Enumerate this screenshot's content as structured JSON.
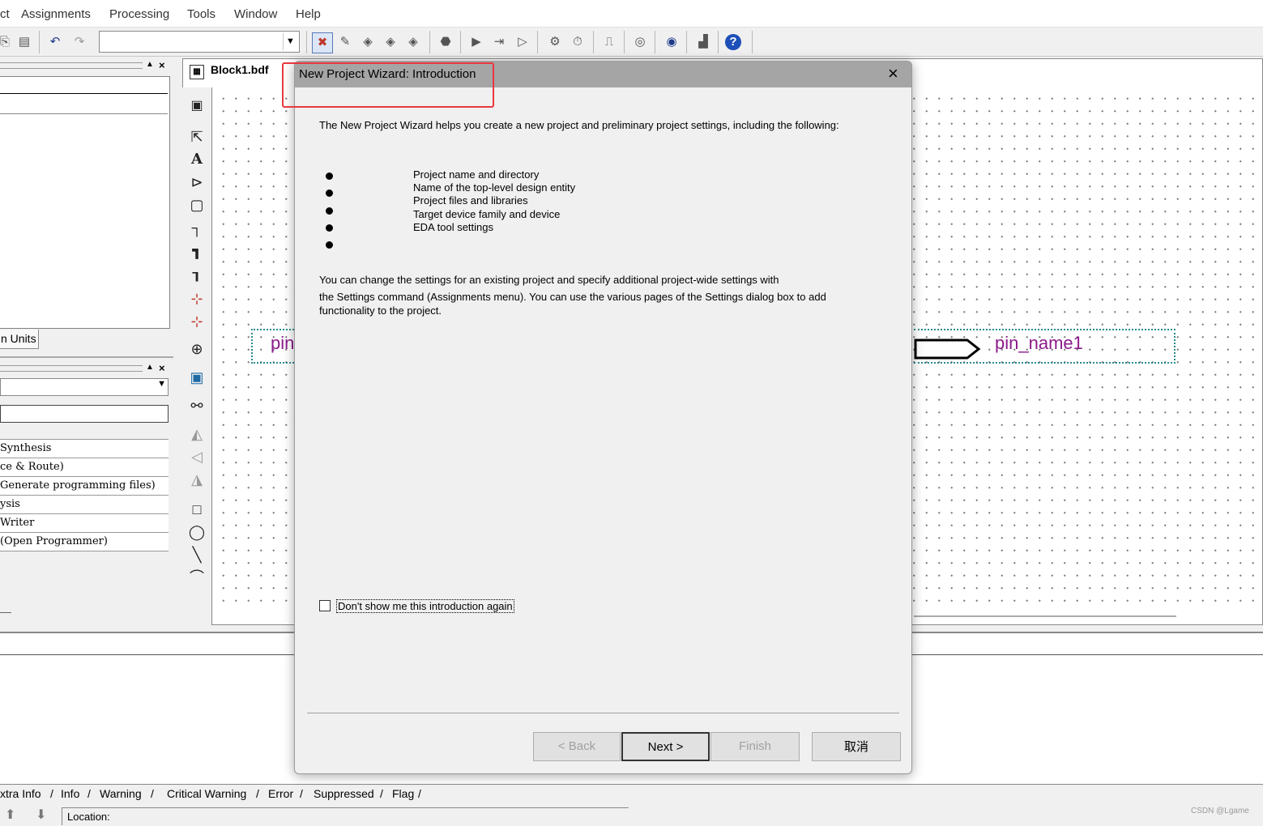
{
  "menu": {
    "items": [
      "ct",
      "Assignments",
      "Processing",
      "Tools",
      "Window",
      "Help"
    ]
  },
  "toolbar": {
    "combo_value": "",
    "icons": [
      "copy-icon",
      "paste-icon",
      "undo-icon",
      "redo-icon",
      "compile-icon",
      "analysis-icon",
      "fitter-icon",
      "assembler-icon",
      "timing-icon",
      "stop-icon",
      "start-icon",
      "start-next-icon",
      "step-icon",
      "rtl-icon",
      "clock-icon",
      "simulate-icon",
      "programmer-icon",
      "chip-icon",
      "netlist-icon",
      "help-icon"
    ]
  },
  "left_panel": {
    "units_tab": "n Units",
    "tasks": [
      "Synthesis",
      "ce & Route)",
      "Generate programming files)",
      "ysis",
      " Writer",
      " (Open Programmer)"
    ]
  },
  "editor": {
    "tab_title": "Block1.bdf",
    "pin_left_label": "pin",
    "pin_right_label": "pin_name1"
  },
  "dialog": {
    "title": "New Project Wizard: Introduction",
    "intro": "The New Project Wizard helps you create a new project and preliminary project settings, including the following:",
    "bullets": [
      "Project name and directory",
      "Name of the top-level design entity",
      "Project files and libraries",
      "Target device family and device",
      "EDA tool settings"
    ],
    "para_line1": "You can change the settings for an existing project and specify additional project-wide settings with",
    "para_line2": "the Settings command (Assignments menu). You can use the various pages of the Settings dialog box to add",
    "para_line3": "functionality to the project.",
    "checkbox_label": "Don't show me this introduction again",
    "checkbox_checked": false,
    "buttons": {
      "back": "< Back",
      "next": "Next >",
      "finish": "Finish",
      "cancel": "取消"
    }
  },
  "messages": {
    "tabs": [
      "xtra Info",
      "Info",
      "Warning",
      "Critical Warning",
      "Error",
      "Suppressed",
      "Flag"
    ],
    "location_label": "Location:"
  },
  "watermark": "CSDN @Lgame",
  "colors": {
    "highlight_box": "#e8383d",
    "pin_text": "#8b1a8b",
    "dialog_title_bg": "#a5a5a5"
  }
}
